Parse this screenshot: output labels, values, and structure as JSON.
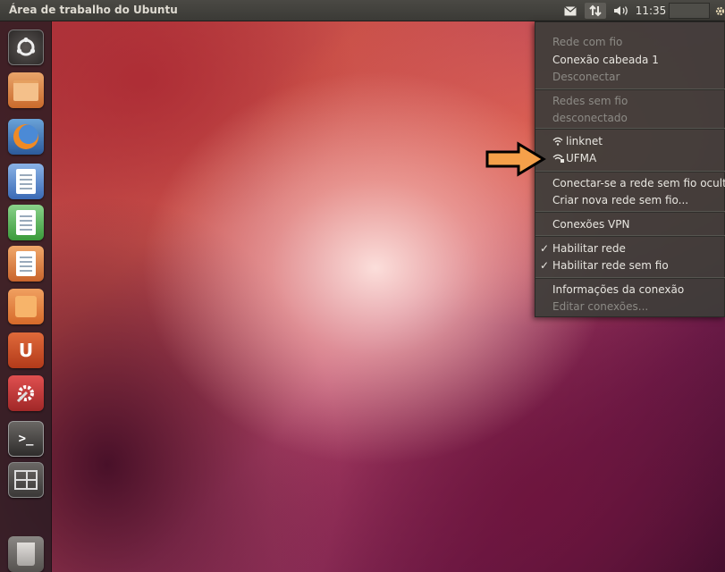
{
  "top_panel": {
    "title": "Área de trabalho do Ubuntu",
    "clock": "11:35",
    "mail_icon": "envelope-icon",
    "network_icon": "network-updown-icon",
    "volume_icon": "speaker-icon",
    "session_icon": "gear-icon"
  },
  "launcher": {
    "items": [
      {
        "name": "dash",
        "icon": "ubuntu-logo-icon"
      },
      {
        "name": "files",
        "icon": "folder-icon"
      },
      {
        "name": "firefox",
        "icon": "firefox-icon"
      },
      {
        "name": "writer",
        "icon": "writer-icon"
      },
      {
        "name": "calc",
        "icon": "calc-icon"
      },
      {
        "name": "impress",
        "icon": "impress-icon"
      },
      {
        "name": "software-center",
        "icon": "shopping-bag-icon"
      },
      {
        "name": "ubuntu-one",
        "icon": "ubuntu-one-icon",
        "glyph": "U"
      },
      {
        "name": "system-settings",
        "icon": "settings-icon"
      },
      {
        "name": "terminal",
        "icon": "terminal-icon",
        "glyph": ">_"
      },
      {
        "name": "workspace-switcher",
        "icon": "workspaces-icon"
      },
      {
        "name": "trash",
        "icon": "trash-icon"
      }
    ]
  },
  "network_menu": {
    "wired_header": "Rede com fio",
    "wired_connection": "Conexão cabeada 1",
    "disconnect": "Desconectar",
    "wireless_header": "Redes sem fio",
    "wireless_status": "desconectado",
    "networks": [
      {
        "ssid": "linknet"
      },
      {
        "ssid": "UFMA"
      }
    ],
    "connect_hidden": "Conectar-se a rede sem fio oculta...",
    "create_new": "Criar nova rede sem fio...",
    "vpn": "Conexões VPN",
    "enable_networking": "Habilitar rede",
    "enable_wireless": "Habilitar rede sem fio",
    "connection_info": "Informações da conexão",
    "edit_connections": "Editar conexões..."
  },
  "colors": {
    "arrow_fill": "#f5a04a",
    "arrow_stroke": "#000000",
    "panel_bg": "#3c3b37",
    "menu_text": "#e8e6e0",
    "menu_disabled": "#8c8a85"
  }
}
